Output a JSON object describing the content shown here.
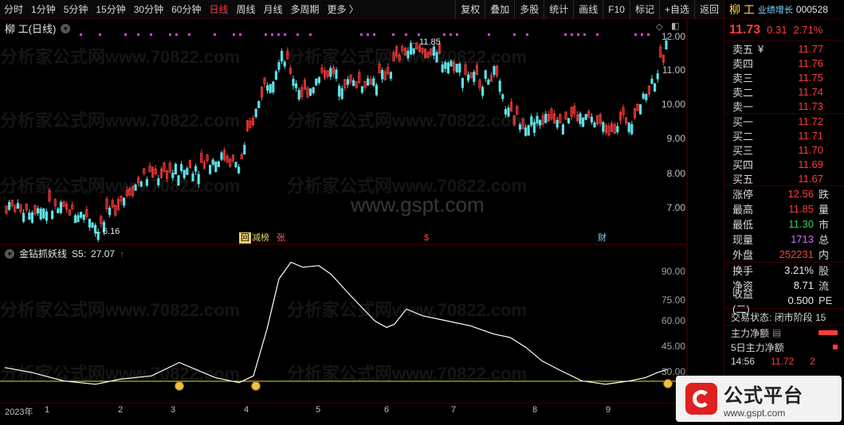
{
  "toolbar": {
    "left": [
      {
        "label": "分时",
        "active": false
      },
      {
        "label": "1分钟",
        "active": false
      },
      {
        "label": "5分钟",
        "active": false
      },
      {
        "label": "15分钟",
        "active": false
      },
      {
        "label": "30分钟",
        "active": false
      },
      {
        "label": "60分钟",
        "active": false
      },
      {
        "label": "日线",
        "active": true
      },
      {
        "label": "周线",
        "active": false
      },
      {
        "label": "月线",
        "active": false
      },
      {
        "label": "多周期",
        "active": false
      },
      {
        "label": "更多 〉",
        "active": false
      }
    ],
    "right": [
      "复权",
      "叠加",
      "多股",
      "统计",
      "画线",
      "F10",
      "标记",
      "+自选",
      "返回"
    ]
  },
  "main_chart": {
    "title": "柳 工(日线)",
    "max_label": "11.85",
    "min_label": "6.16",
    "y_ticks": [
      "12.00",
      "11.00",
      "10.00",
      "9.00",
      "8.00",
      "7.00"
    ],
    "tags": [
      "回",
      "减榜",
      "张",
      "$",
      "财"
    ]
  },
  "indicator": {
    "title": "金钻抓妖线",
    "series_label": "S5:",
    "value": "27.07",
    "arrow": "↑",
    "y_ticks": [
      "90.00",
      "75.00",
      "60.00",
      "45.00",
      "30.00"
    ]
  },
  "xaxis": [
    "2023年",
    "1",
    "2",
    "3",
    "4",
    "5",
    "6",
    "7",
    "8",
    "9"
  ],
  "watermark": {
    "text": "分析家公式网www.70822.com",
    "site": "www.gspt.com"
  },
  "panel": {
    "name": "柳 工",
    "tag": "业绩增长",
    "code": "000528",
    "price": "11.73",
    "change": "0.31",
    "change_pct": "2.71%",
    "asks": [
      {
        "label": "卖五",
        "mark": "¥",
        "price": "11.77"
      },
      {
        "label": "卖四",
        "mark": "",
        "price": "11.76"
      },
      {
        "label": "卖三",
        "mark": "",
        "price": "11.75"
      },
      {
        "label": "卖二",
        "mark": "",
        "price": "11.74"
      },
      {
        "label": "卖一",
        "mark": "",
        "price": "11.73"
      }
    ],
    "bids": [
      {
        "label": "买一",
        "price": "11.72"
      },
      {
        "label": "买二",
        "price": "11.71"
      },
      {
        "label": "买三",
        "price": "11.70"
      },
      {
        "label": "买四",
        "price": "11.69"
      },
      {
        "label": "买五",
        "price": "11.67"
      }
    ],
    "stats1": [
      {
        "label": "涨停",
        "value": "12.56",
        "color": "#ff3b3b",
        "extra": "跌"
      },
      {
        "label": "最高",
        "value": "11.85",
        "color": "#ff3b3b",
        "extra": "量"
      },
      {
        "label": "最低",
        "value": "11.30",
        "color": "#39d353",
        "extra": "市"
      },
      {
        "label": "现量",
        "value": "1713",
        "color": "#d070ff",
        "extra": "总"
      },
      {
        "label": "外盘",
        "value": "252231",
        "color": "#ff3b3b",
        "extra": "内"
      }
    ],
    "stats2": [
      {
        "label": "换手",
        "value": "3.21%",
        "color": "#e8e8e8",
        "extra": "股"
      },
      {
        "label": "净资",
        "value": "8.71",
        "color": "#e8e8e8",
        "extra": "流"
      },
      {
        "label": "收益(二)",
        "value": "0.500",
        "color": "#e8e8e8",
        "extra": "PE"
      }
    ],
    "trade_status": "交易状态: 闭市阶段 15",
    "flows": [
      {
        "label": "主力净额",
        "icon": "▤",
        "bar": 0.6
      },
      {
        "label": "5日主力净额",
        "icon": "",
        "bar": 0.15
      }
    ],
    "time_row": {
      "time": "14:56",
      "price": "11.72",
      "vol": "2"
    }
  },
  "logo": {
    "title": "公式平台",
    "url": "www.gspt.com"
  },
  "colors": {
    "up": "#ff3b3b",
    "down": "#5ce0e6",
    "indicator": "#ffffff",
    "baseline": "#e6e600",
    "signal": "#ff33ff"
  }
}
